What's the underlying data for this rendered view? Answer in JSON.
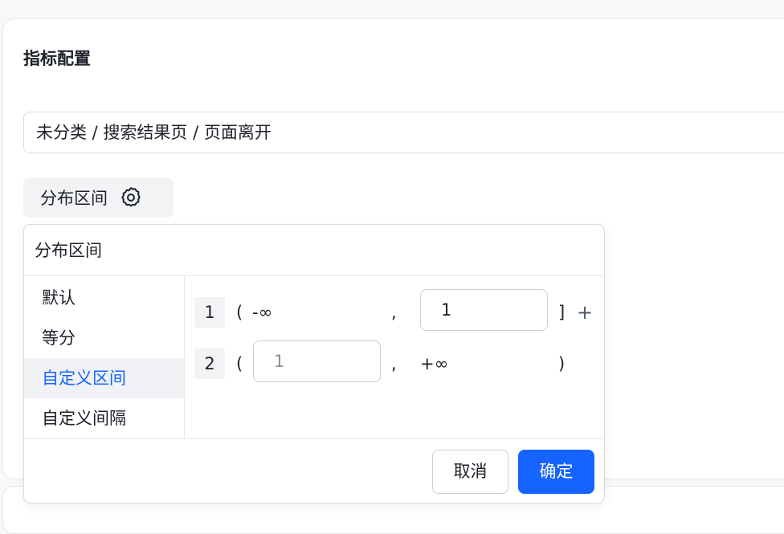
{
  "panel": {
    "title": "指标配置",
    "metric_path": "未分类 / 搜索结果页 / 页面离开"
  },
  "distribution_button": {
    "label": "分布区间",
    "icon": "gear-icon"
  },
  "popover": {
    "title": "分布区间",
    "menu": [
      {
        "label": "默认",
        "active": false
      },
      {
        "label": "等分",
        "active": false
      },
      {
        "label": "自定义区间",
        "active": true
      },
      {
        "label": "自定义间隔",
        "active": false
      }
    ],
    "rows": [
      {
        "index": "1",
        "open": "(",
        "lower": "-∞",
        "comma": ",",
        "upper_value": "1",
        "close": "]",
        "add": "+"
      },
      {
        "index": "2",
        "open": "(",
        "lower_placeholder": "1",
        "comma": ",",
        "upper": "+∞",
        "close": ")"
      }
    ],
    "cancel_label": "取消",
    "confirm_label": "确定"
  },
  "colors": {
    "accent": "#1664ff",
    "active_bg": "#f0f2f6"
  }
}
